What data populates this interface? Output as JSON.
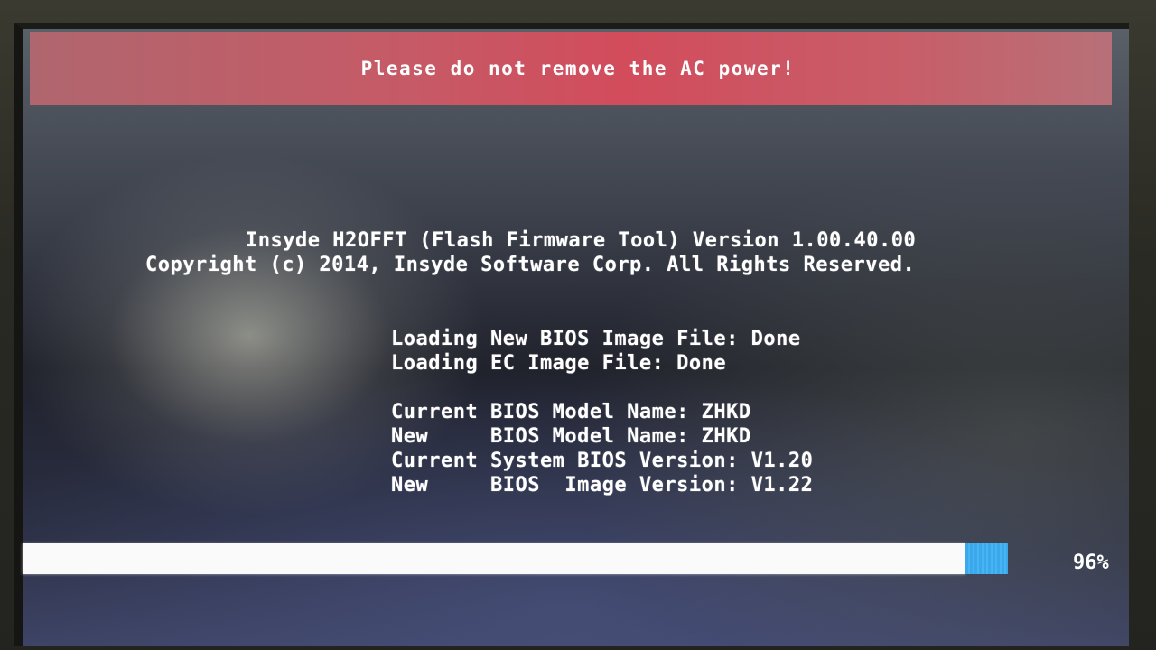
{
  "banner": {
    "warning": "Please do not remove the AC power!",
    "color": "#d24c5c"
  },
  "header": {
    "title_line": "Insyde H2OFFT (Flash Firmware Tool) Version 1.00.40.00",
    "copyright_line": "Copyright (c) 2014, Insyde Software Corp. All Rights Reserved."
  },
  "loading": [
    {
      "text": "Loading New BIOS Image File: Done"
    },
    {
      "text": "Loading EC Image File: Done"
    }
  ],
  "info": [
    {
      "text": "Current BIOS Model Name: ZHKD"
    },
    {
      "text": "New     BIOS Model Name: ZHKD"
    },
    {
      "text": "Current System BIOS Version: V1.20"
    },
    {
      "text": "New     BIOS  Image Version: V1.22"
    }
  ],
  "progress": {
    "percent": 96,
    "label": "96%",
    "fill_color": "#fafafa",
    "cursor_color": "#3aa8ea"
  }
}
